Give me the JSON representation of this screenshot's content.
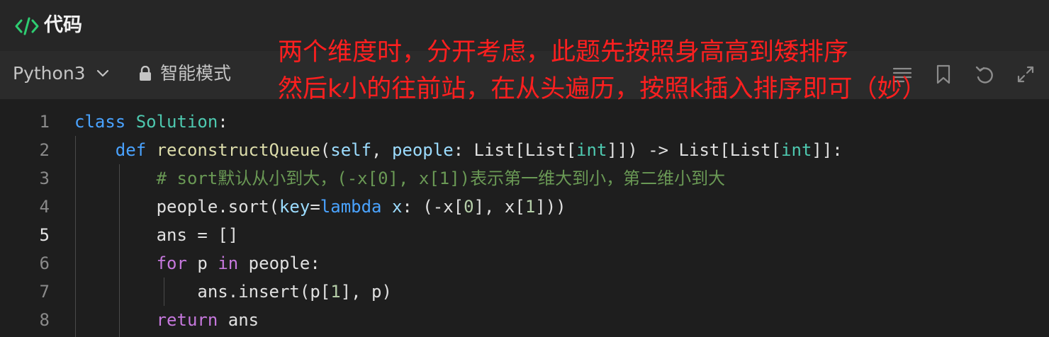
{
  "header": {
    "title": "代码",
    "icon": "code-icon",
    "accent": "#2ecc71"
  },
  "toolbar": {
    "language": "Python3",
    "mode_label": "智能模式",
    "icons": [
      "list-icon",
      "bookmark-icon",
      "undo-icon",
      "expand-icon"
    ]
  },
  "annotation": {
    "line1": "两个维度时，分开考虑，此题先按照身高高到矮排序",
    "line2": "然后k小的往前站，在从头遍历，按照k插入排序即可（妙）",
    "color": "#ff1f1f"
  },
  "editor": {
    "line_numbers": [
      "1",
      "2",
      "3",
      "4",
      "5",
      "6",
      "7",
      "8"
    ],
    "active_line": 5,
    "lines": [
      {
        "t_class": "class",
        "t_name": "Solution",
        "t_colon": ":"
      },
      {
        "t_def": "def",
        "t_fn": "reconstructQueue",
        "t_p1": "(",
        "t_self": "self",
        "t_p2": ", ",
        "t_people": "people",
        "t_p3": ": List[List[",
        "t_int1": "int",
        "t_p4": "]]) -> List[List[",
        "t_int2": "int",
        "t_p5": "]]:"
      },
      {
        "t_comment": "# sort默认从小到大，(-x[0], x[1])表示第一维大到小，第二维小到大"
      },
      {
        "t_a": "people.sort(",
        "t_key": "key",
        "t_b": "=",
        "t_lambda": "lambda",
        "t_c": " ",
        "t_x": "x",
        "t_d": ": (-x[",
        "t_n0": "0",
        "t_e": "], x[",
        "t_n1": "1",
        "t_f": "]))"
      },
      {
        "t_a": "ans = []"
      },
      {
        "t_for": "for",
        "t_a": " p ",
        "t_in": "in",
        "t_b": " people:"
      },
      {
        "t_a": "ans.insert(p[",
        "t_n1": "1",
        "t_b": "], p)"
      },
      {
        "t_return": "return",
        "t_a": " ans"
      }
    ]
  }
}
